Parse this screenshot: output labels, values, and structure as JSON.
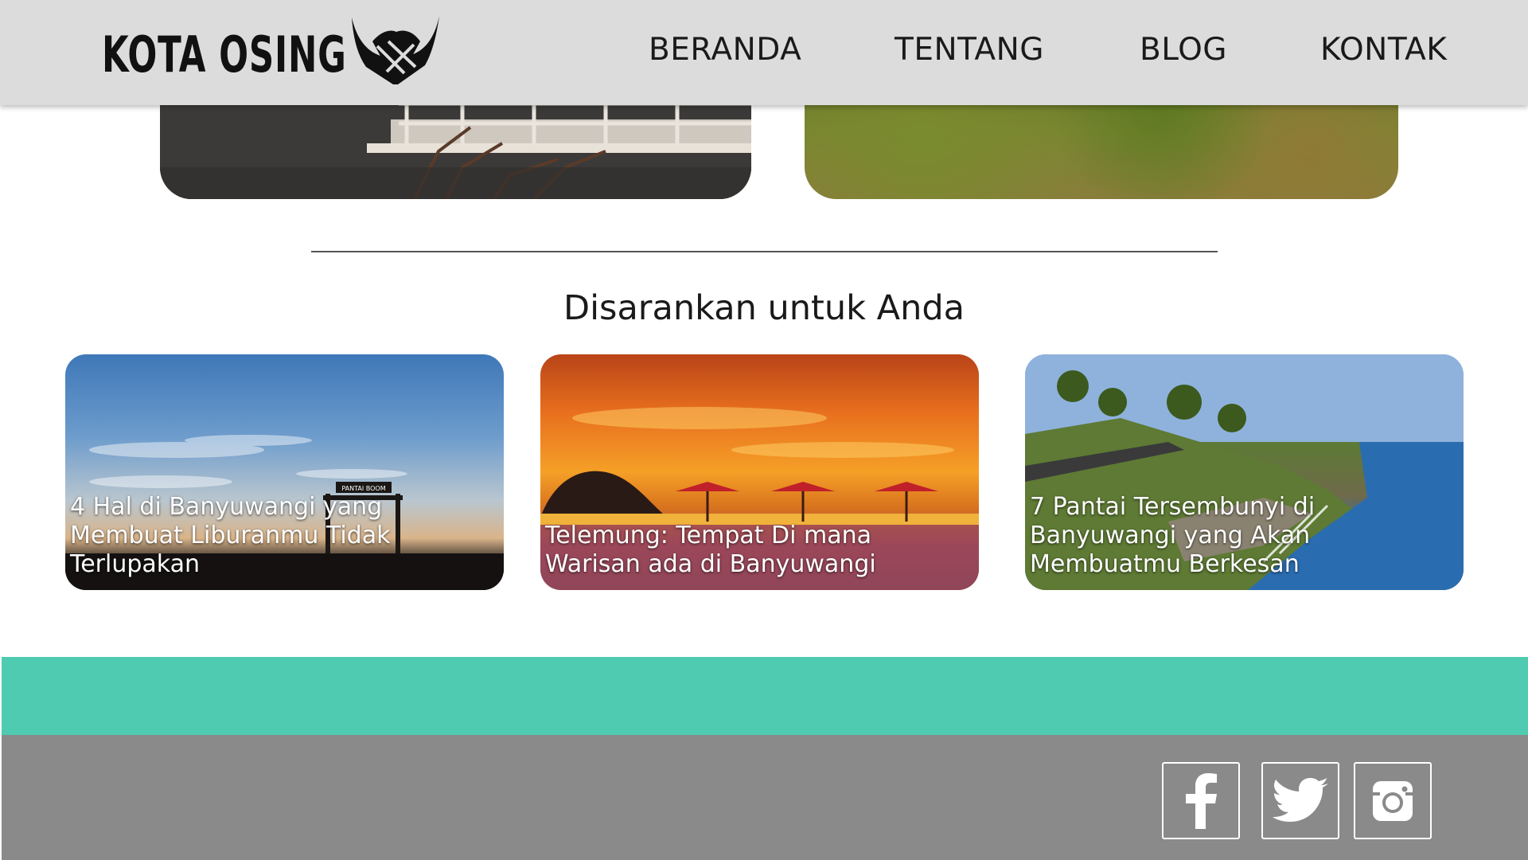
{
  "header": {
    "logo_text": "KOTA OSING",
    "nav": [
      {
        "label": "BERANDA"
      },
      {
        "label": "TENTANG"
      },
      {
        "label": "BLOG"
      },
      {
        "label": "KONTAK"
      }
    ]
  },
  "recommendations": {
    "heading": "Disarankan untuk Anda",
    "items": [
      {
        "title": "4 Hal di Banyuwangi yang Membuat Liburanmu Tidak Terlupakan",
        "sign_text": "PANTAI BOOM"
      },
      {
        "title": "Telemung: Tempat Di mana Warisan ada di Banyuwangi"
      },
      {
        "title": "7 Pantai Tersembunyi di Banyuwangi yang Akan Membuatmu Berkesan"
      }
    ]
  },
  "footer": {
    "social": [
      {
        "icon": "facebook-icon"
      },
      {
        "icon": "twitter-icon"
      },
      {
        "icon": "instagram-icon"
      }
    ]
  },
  "colors": {
    "header_bg": "#dcdcdc",
    "teal_band": "#4ecbb1",
    "footer_bg": "#8a8a8a"
  }
}
